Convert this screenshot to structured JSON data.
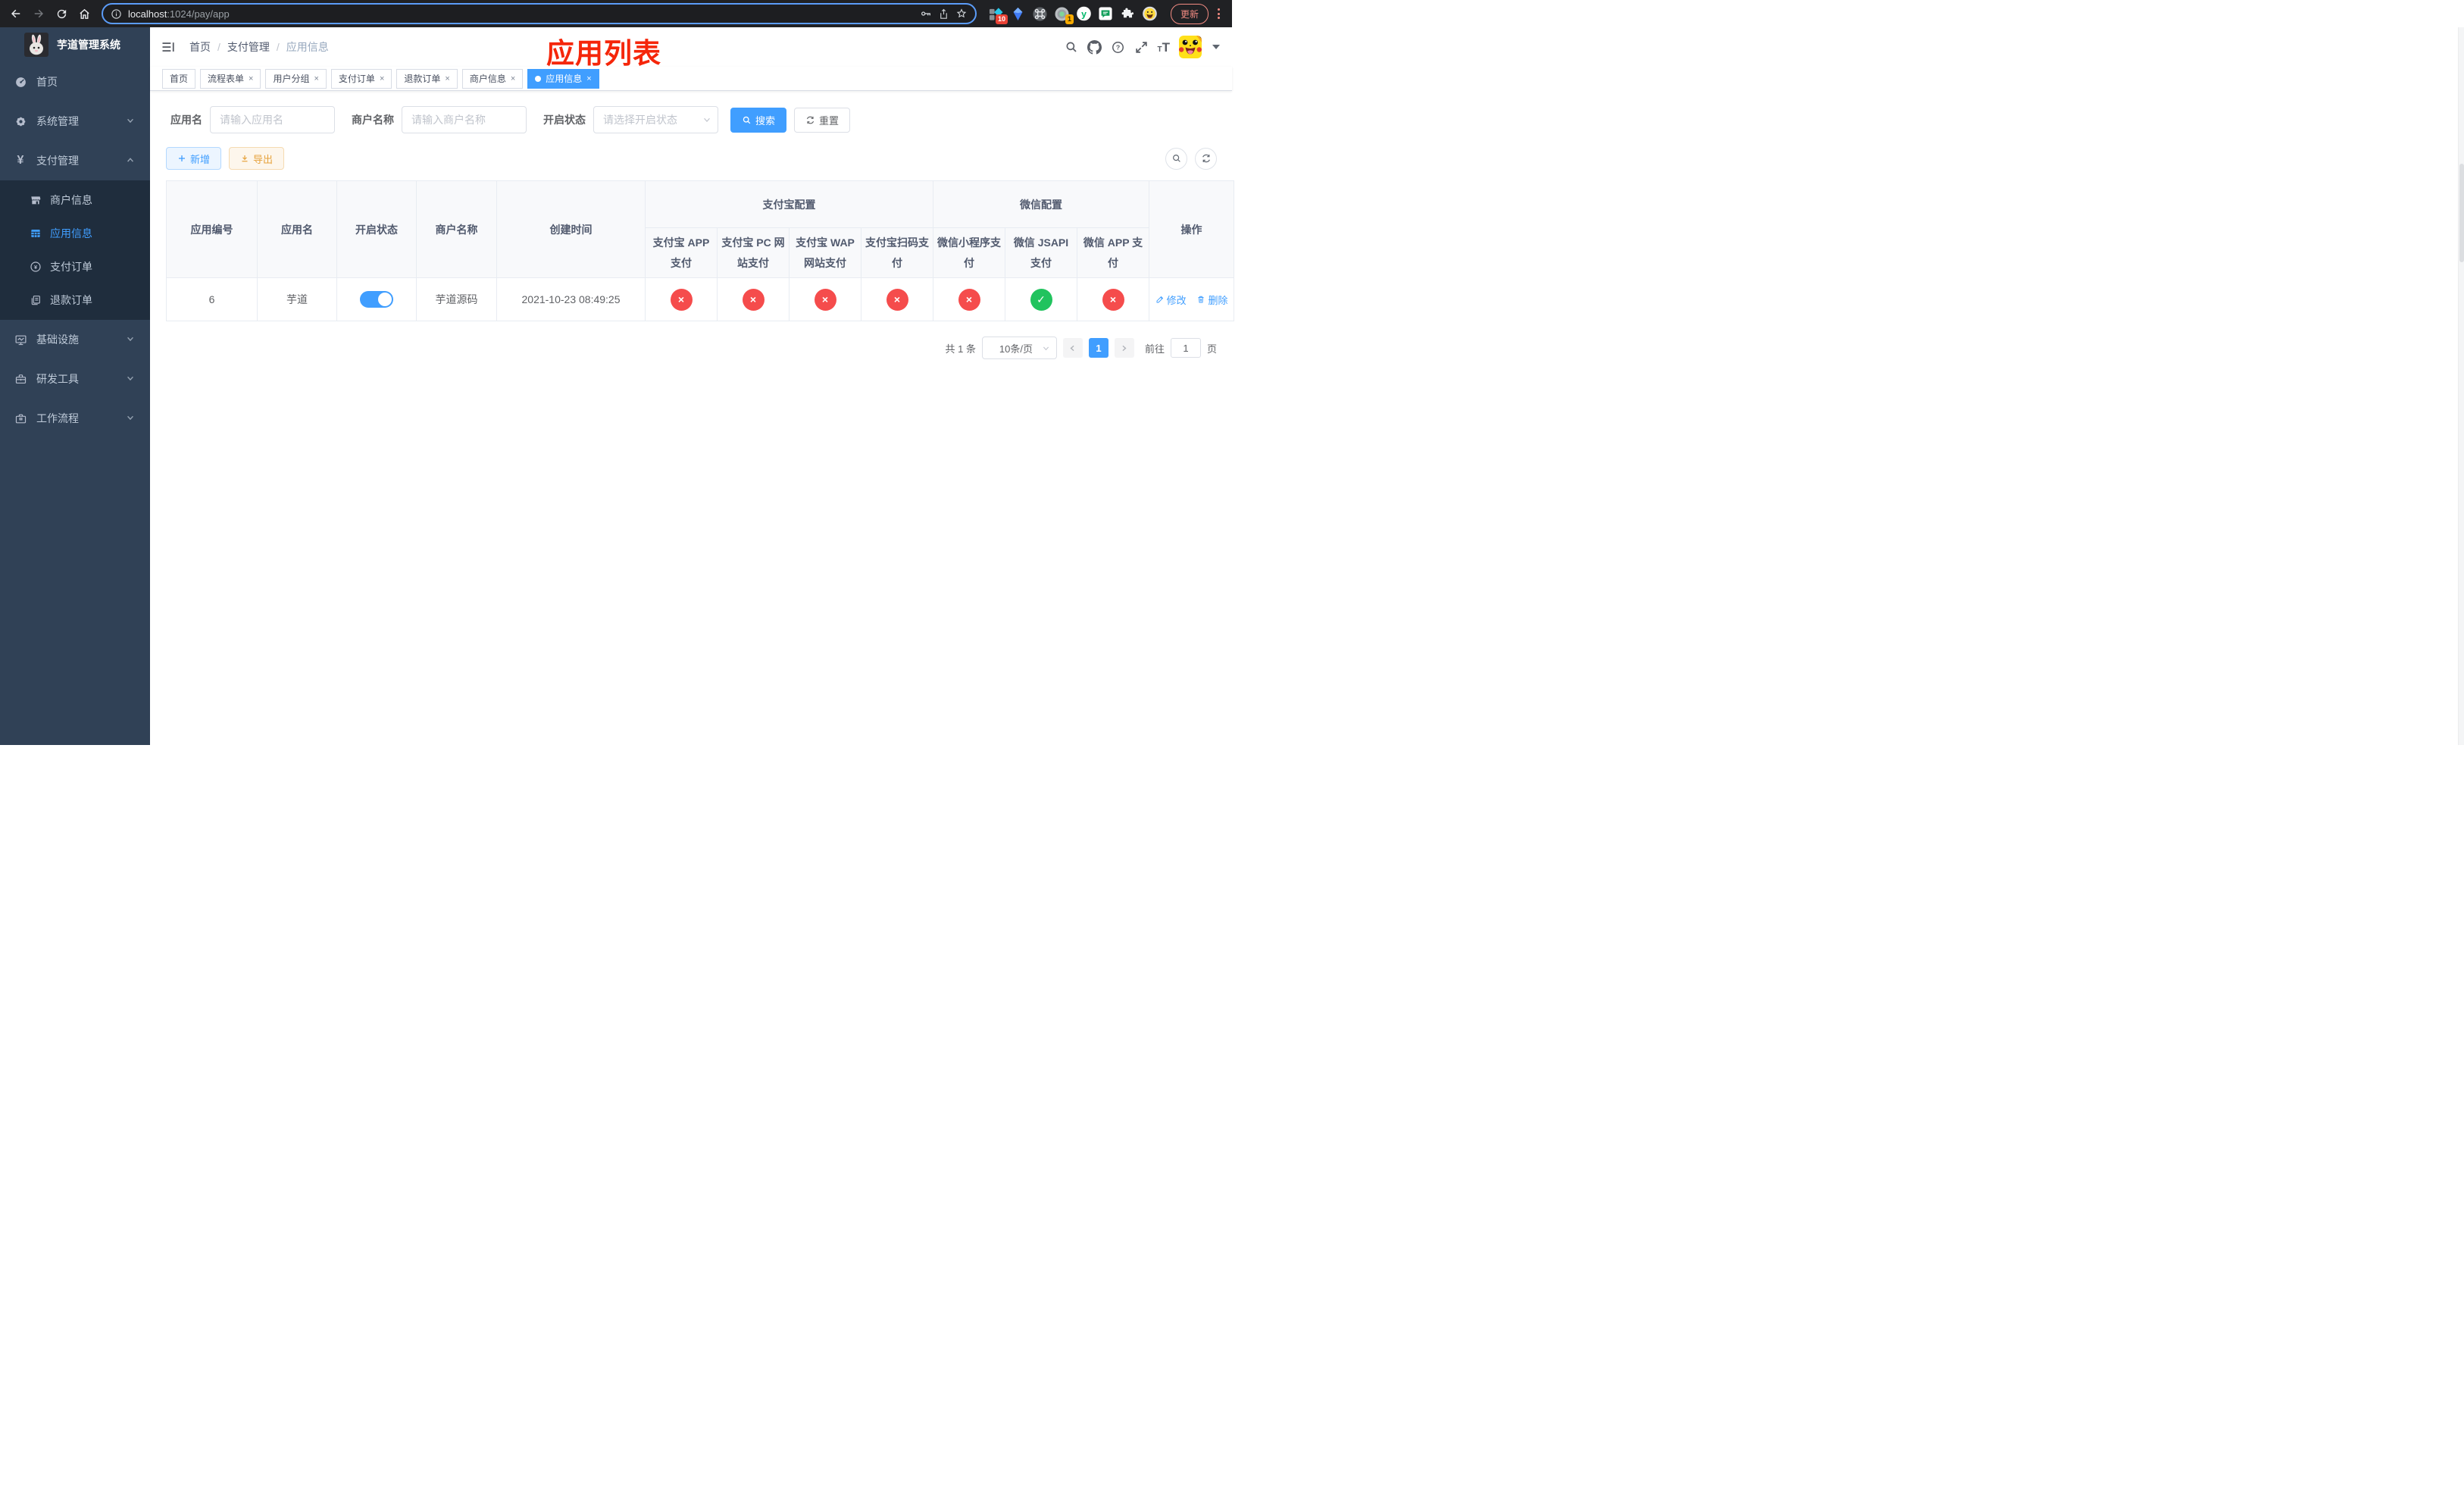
{
  "browser": {
    "url_host": "localhost",
    "url_path": ":1024/pay/app",
    "update_label": "更新",
    "badges": [
      "10",
      "1"
    ]
  },
  "sidebar": {
    "title": "芋道管理系统",
    "menu": [
      {
        "label": "首页",
        "icon": "dashboard-icon"
      },
      {
        "label": "系统管理",
        "icon": "gear-icon"
      },
      {
        "label": "支付管理",
        "icon": "yen-icon"
      },
      {
        "label": "商户信息",
        "icon": "shop-icon"
      },
      {
        "label": "应用信息",
        "icon": "grid-icon"
      },
      {
        "label": "支付订单",
        "icon": "yen-circle-icon"
      },
      {
        "label": "退款订单",
        "icon": "documents-icon"
      },
      {
        "label": "基础设施",
        "icon": "monitor-icon"
      },
      {
        "label": "研发工具",
        "icon": "toolbox-icon"
      },
      {
        "label": "工作流程",
        "icon": "briefcase-icon"
      }
    ]
  },
  "header": {
    "breadcrumb": [
      "首页",
      "支付管理",
      "应用信息"
    ],
    "page_title": "应用列表"
  },
  "tags": [
    {
      "label": "首页"
    },
    {
      "label": "流程表单"
    },
    {
      "label": "用户分组"
    },
    {
      "label": "支付订单"
    },
    {
      "label": "退款订单"
    },
    {
      "label": "商户信息"
    },
    {
      "label": "应用信息"
    }
  ],
  "search": {
    "fields": [
      {
        "label": "应用名",
        "placeholder": "请输入应用名"
      },
      {
        "label": "商户名称",
        "placeholder": "请输入商户名称"
      },
      {
        "label": "开启状态",
        "placeholder": "请选择开启状态"
      }
    ],
    "search_label": "搜索",
    "reset_label": "重置"
  },
  "toolbar": {
    "add_label": "新增",
    "export_label": "导出"
  },
  "table": {
    "main_columns": [
      "应用编号",
      "应用名",
      "开启状态",
      "商户名称",
      "创建时间"
    ],
    "group_headers": [
      "支付宝配置",
      "微信配置"
    ],
    "sub_columns": [
      "支付宝 APP 支付",
      "支付宝 PC 网站支付",
      "支付宝 WAP 网站支付",
      "支付宝扫码支付",
      "微信小程序支付",
      "微信 JSAPI 支付",
      "微信 APP 支付"
    ],
    "op_column": "操作",
    "row": {
      "id": "6",
      "name": "芋道",
      "enabled": true,
      "merchant": "芋道源码",
      "created": "2021-10-23 08:49:25",
      "statuses": [
        "fail",
        "fail",
        "fail",
        "fail",
        "fail",
        "success",
        "fail"
      ],
      "edit_label": "修改",
      "delete_label": "删除"
    }
  },
  "pagination": {
    "total": "共 1 条",
    "size": "10条/页",
    "page": "1",
    "goto_label": "前往",
    "goto_value": "1",
    "unit": "页"
  },
  "colors": {
    "primary": "#409eff",
    "success": "#21c35e",
    "danger": "#f54c4c",
    "warning": "#e6a23c",
    "annotation_red": "#f5260a",
    "sidebar_bg": "#304156",
    "submenu_bg": "#1f2d3d"
  }
}
